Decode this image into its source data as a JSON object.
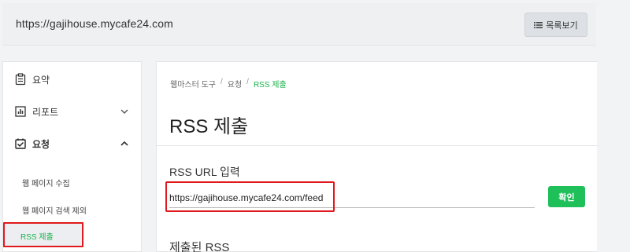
{
  "header": {
    "site_url": "https://gajihouse.mycafe24.com",
    "list_button_label": "목록보기",
    "list_icon": "list-icon"
  },
  "sidebar": {
    "items": [
      {
        "label": "요약",
        "icon": "clipboard-icon"
      },
      {
        "label": "리포트",
        "icon": "report-chart-icon",
        "chevron": "down"
      },
      {
        "label": "요청",
        "icon": "checkbox-icon",
        "chevron": "up",
        "expanded": true
      }
    ],
    "sub_items": [
      "웹 페이지 수집",
      "웹 페이지 검색 제외",
      "RSS 제출"
    ],
    "active_sub_item": "RSS 제출"
  },
  "breadcrumb": [
    "웹마스터 도구",
    "요청",
    "RSS 제출"
  ],
  "breadcrumb_separator": "/",
  "main": {
    "title": "RSS 제출",
    "field_label": "RSS URL 입력",
    "url_value": "https://gajihouse.mycafe24.com/feed",
    "confirm_label": "확인",
    "submitted_heading": "제출된 RSS"
  },
  "colors": {
    "accent_green": "#1fbf5a",
    "highlight_red": "#e0191e",
    "active_text": "#19b34a"
  }
}
